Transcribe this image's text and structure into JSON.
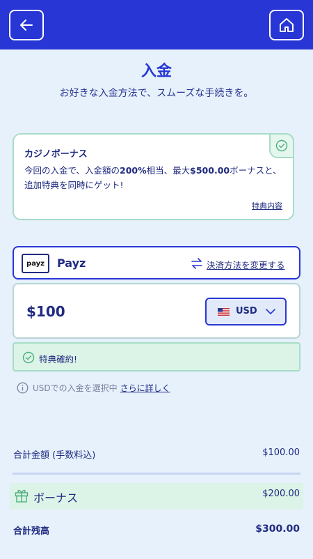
{
  "header": {
    "back_icon": "arrow-left-icon",
    "home_icon": "home-icon",
    "bar_color": "#2836d6"
  },
  "page": {
    "title": "入金",
    "subtitle": "お好きな入金方法で、スムーズな手続きを。"
  },
  "bonus_card": {
    "title": "カジノボーナス",
    "desc_1": "今回の入金で、入金額の",
    "desc_percent": "200%",
    "desc_2": "相当、最大",
    "desc_amount": "$500.00",
    "desc_3": "ボーナスと、追加特典を同時にゲット!",
    "link": "特典内容",
    "check_icon": "check-circle-icon"
  },
  "payment": {
    "logo_text": "payz",
    "name": "Payz",
    "change_icon": "swap-arrows-icon",
    "change_link": "決済方法を変更する"
  },
  "amount": {
    "value": "$100",
    "currency": "USD",
    "flag_icon": "us-flag-icon",
    "chevron_icon": "chevron-down-icon"
  },
  "confirm": {
    "icon": "check-circle-icon",
    "text": "特典確約!"
  },
  "info": {
    "icon": "info-circle-icon",
    "text": "USDでの入金を選択中",
    "link": "さらに詳しく"
  },
  "summary": {
    "total_label": "合計金額 (手数料込)",
    "total_value": "$100.00",
    "bonus_icon": "gift-icon",
    "bonus_label": "ボーナス",
    "bonus_value": "$200.00",
    "balance_label": "合計残高",
    "balance_value": "$300.00"
  },
  "colors": {
    "primary": "#2836d6",
    "background": "#e6f1fc",
    "success_bg": "#dcf3e7",
    "success_border": "#a8dcc6"
  }
}
